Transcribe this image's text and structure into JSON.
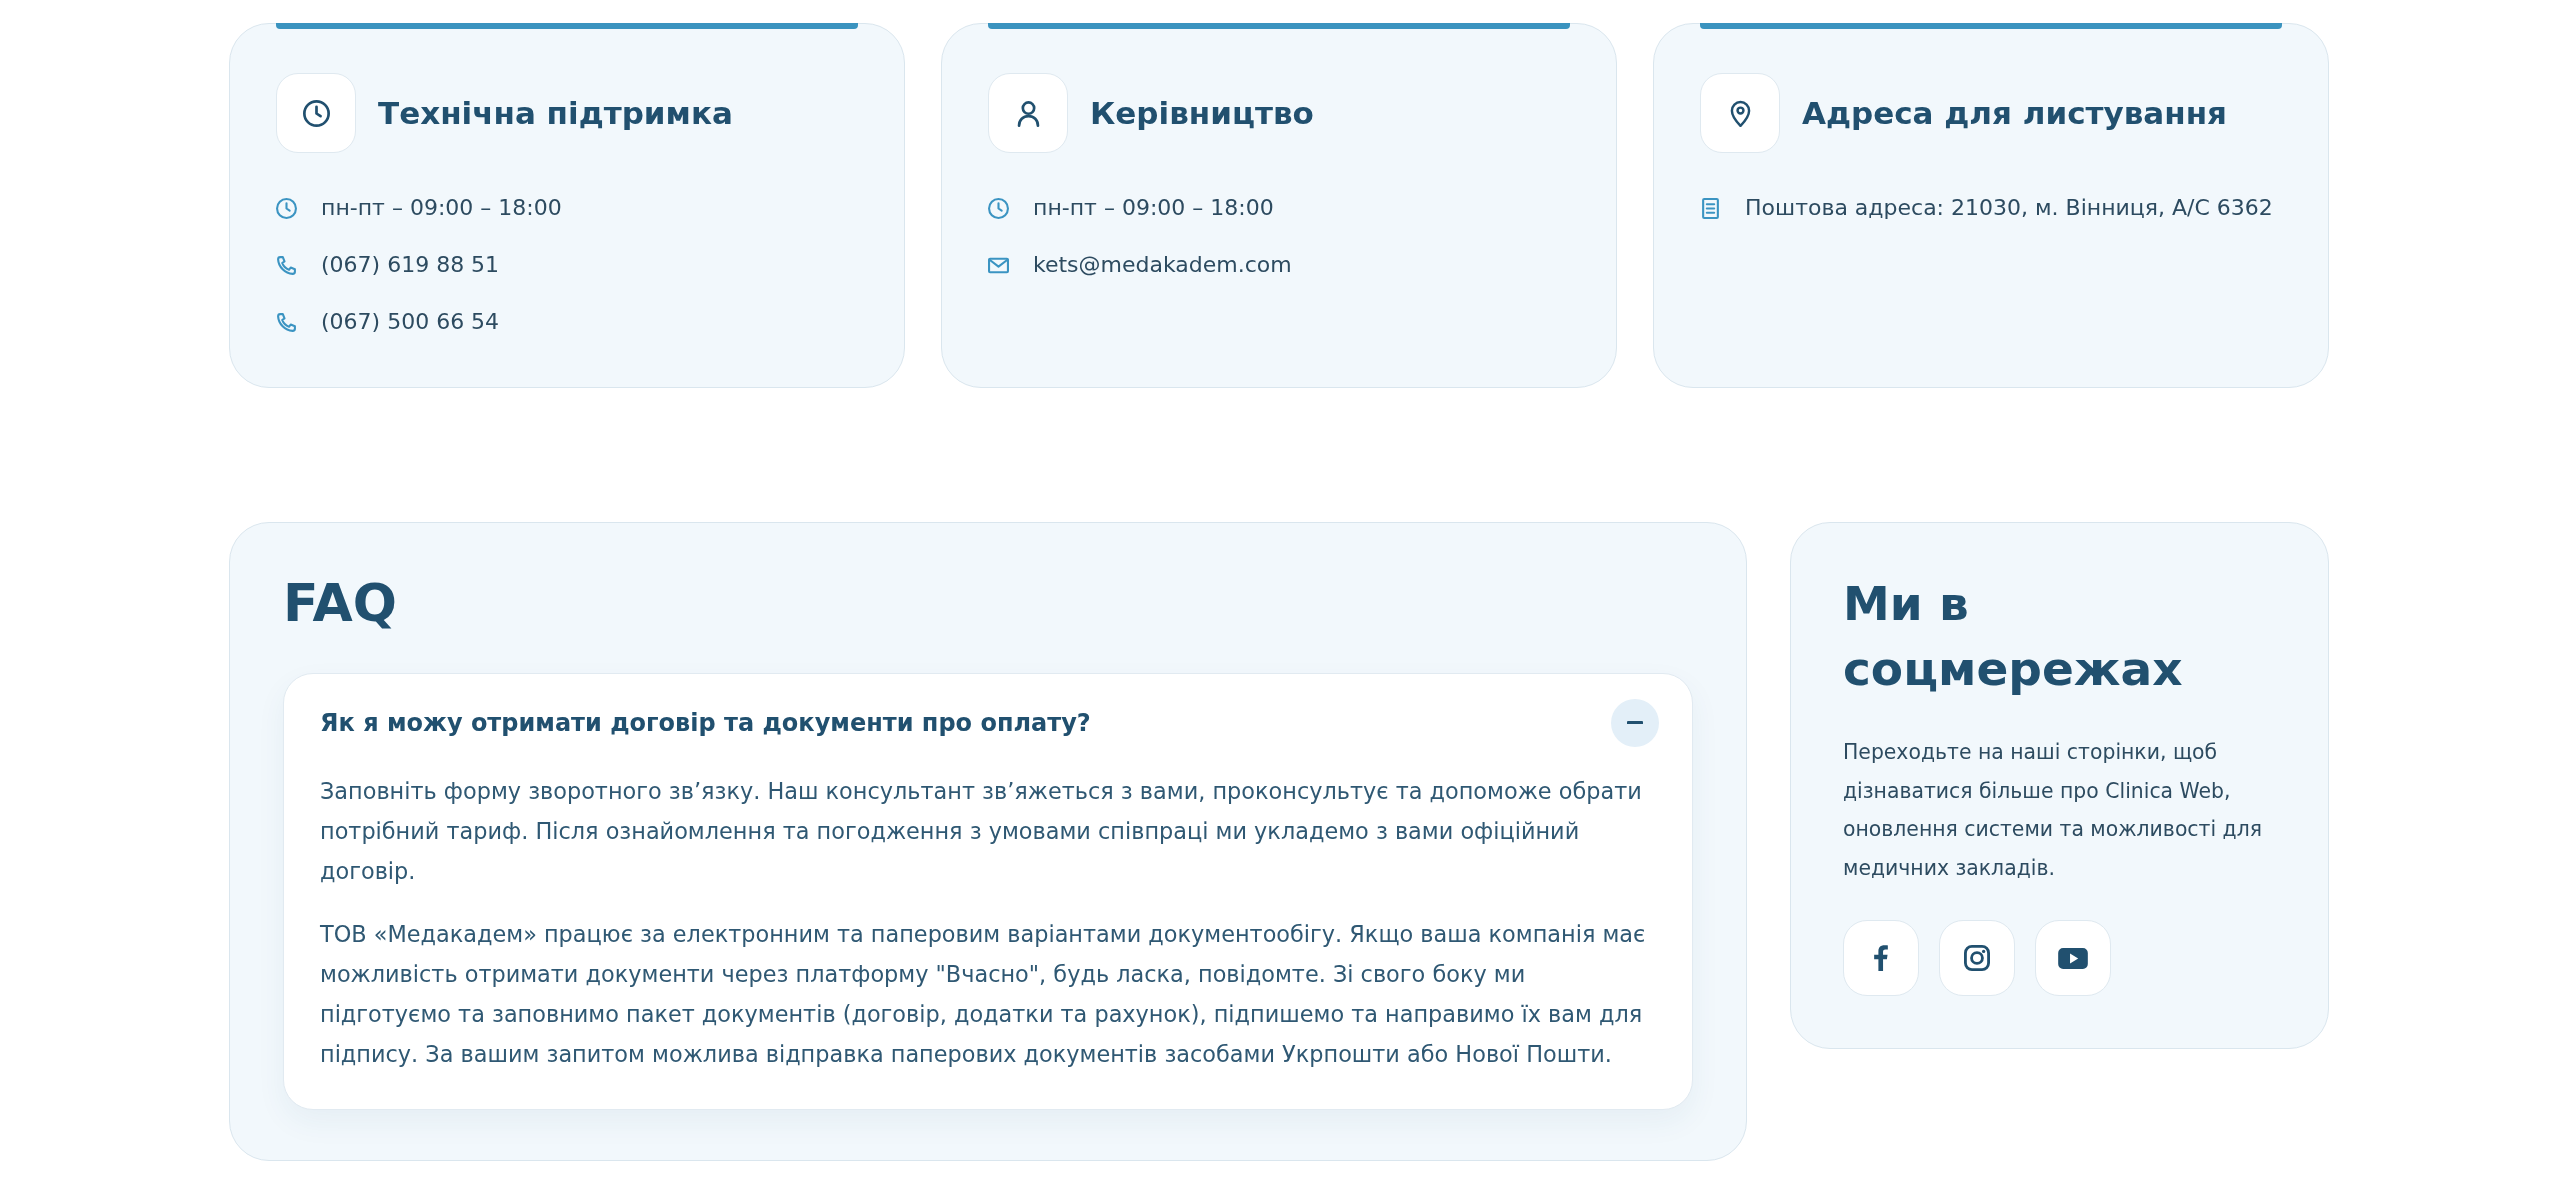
{
  "contact_cards": [
    {
      "kind": "support",
      "title": "Технічна підтримка",
      "items": [
        {
          "kind": "hours",
          "text": "пн-пт – 09:00 – 18:00"
        },
        {
          "kind": "phone",
          "text": "(067) 619 88 51"
        },
        {
          "kind": "phone",
          "text": "(067) 500 66 54"
        }
      ]
    },
    {
      "kind": "management",
      "title": "Керівництво",
      "items": [
        {
          "kind": "hours",
          "text": "пн-пт – 09:00 – 18:00"
        },
        {
          "kind": "email",
          "text": "kets@medakadem.com"
        }
      ]
    },
    {
      "kind": "address",
      "title": "Адреса для листування",
      "items": [
        {
          "kind": "address",
          "text": "Поштова адреса: 21030, м. Вінниця, А/С 6362"
        }
      ]
    }
  ],
  "faq": {
    "title": "FAQ",
    "items": [
      {
        "question": "Як я можу отримати договір та документи про оплату?",
        "expanded": true,
        "answer": [
          "Заповніть форму зворотного зв’язку. Наш консультант зв’яжеться з вами, проконсультує та допоможе обрати потрібний тариф. Після ознайомлення та погодження з умовами співпраці ми укладемо з вами офіційний договір.",
          "ТОВ «Медакадем» працює за електронним та паперовим варіантами документообігу. Якщо ваша компанія має можливість отримати документи через платформу \"Вчасно\", будь ласка, повідомте. Зі свого боку ми підготуємо та заповнимо пакет документів (договір, додатки та рахунок), підпишемо та направимо їх вам для підпису. За вашим запитом можлива відправка паперових документів засобами Укрпошти або Нової Пошти."
        ]
      }
    ]
  },
  "social": {
    "title": "Ми в соцмережах",
    "text": "Переходьте на наші сторінки, щоб дізнаватися більше про Clinica Web, оновлення системи та можливості для медичних закладів.",
    "links": [
      {
        "kind": "facebook"
      },
      {
        "kind": "instagram"
      },
      {
        "kind": "youtube"
      }
    ]
  }
}
